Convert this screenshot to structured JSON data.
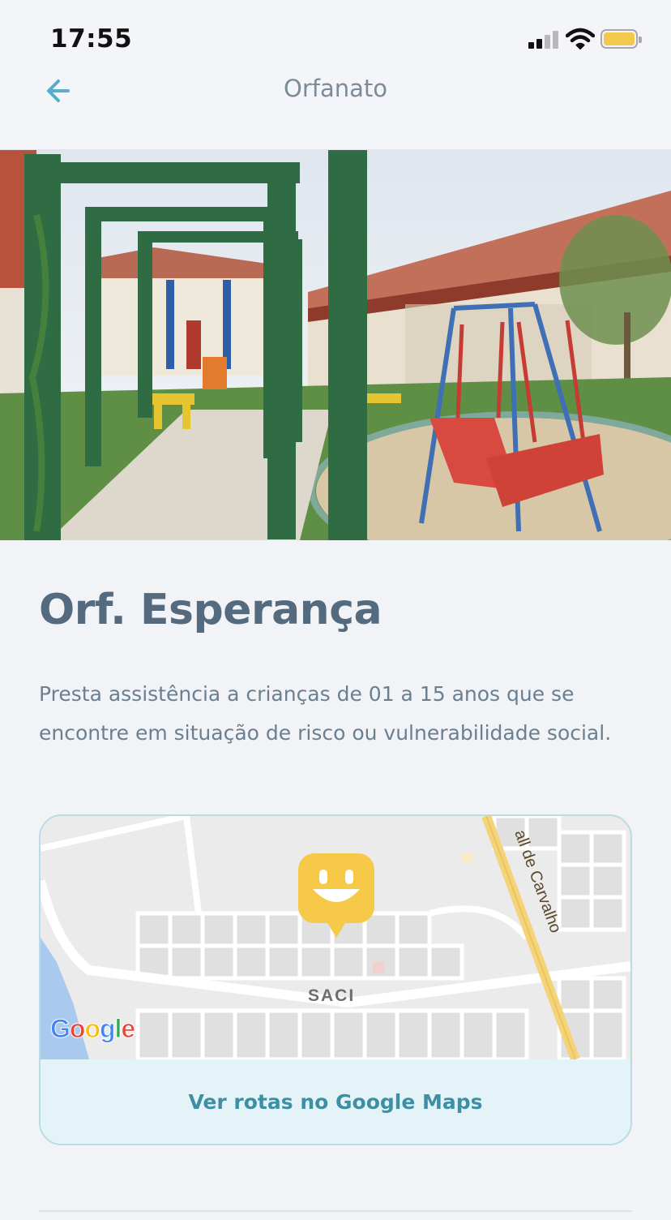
{
  "status_bar": {
    "time": "17:55",
    "battery_color": "#f2c94c"
  },
  "nav": {
    "title": "Orfanato",
    "back_icon": "arrow-left-icon",
    "accent": "#55aeca"
  },
  "place": {
    "name": "Orf. Esperança",
    "description": "Presta assistência a crianças de 01 a 15 anos que se encontre em situação de risco ou vulnerabilidade social."
  },
  "map": {
    "street_label": "all de Carvalho",
    "district_label": "SACI",
    "google_logo": [
      "G",
      "o",
      "o",
      "g",
      "l",
      "e"
    ],
    "marker_icon": "smiley-marker-icon",
    "marker_color": "#f7c948",
    "route_button": "Ver rotas no Google Maps"
  }
}
